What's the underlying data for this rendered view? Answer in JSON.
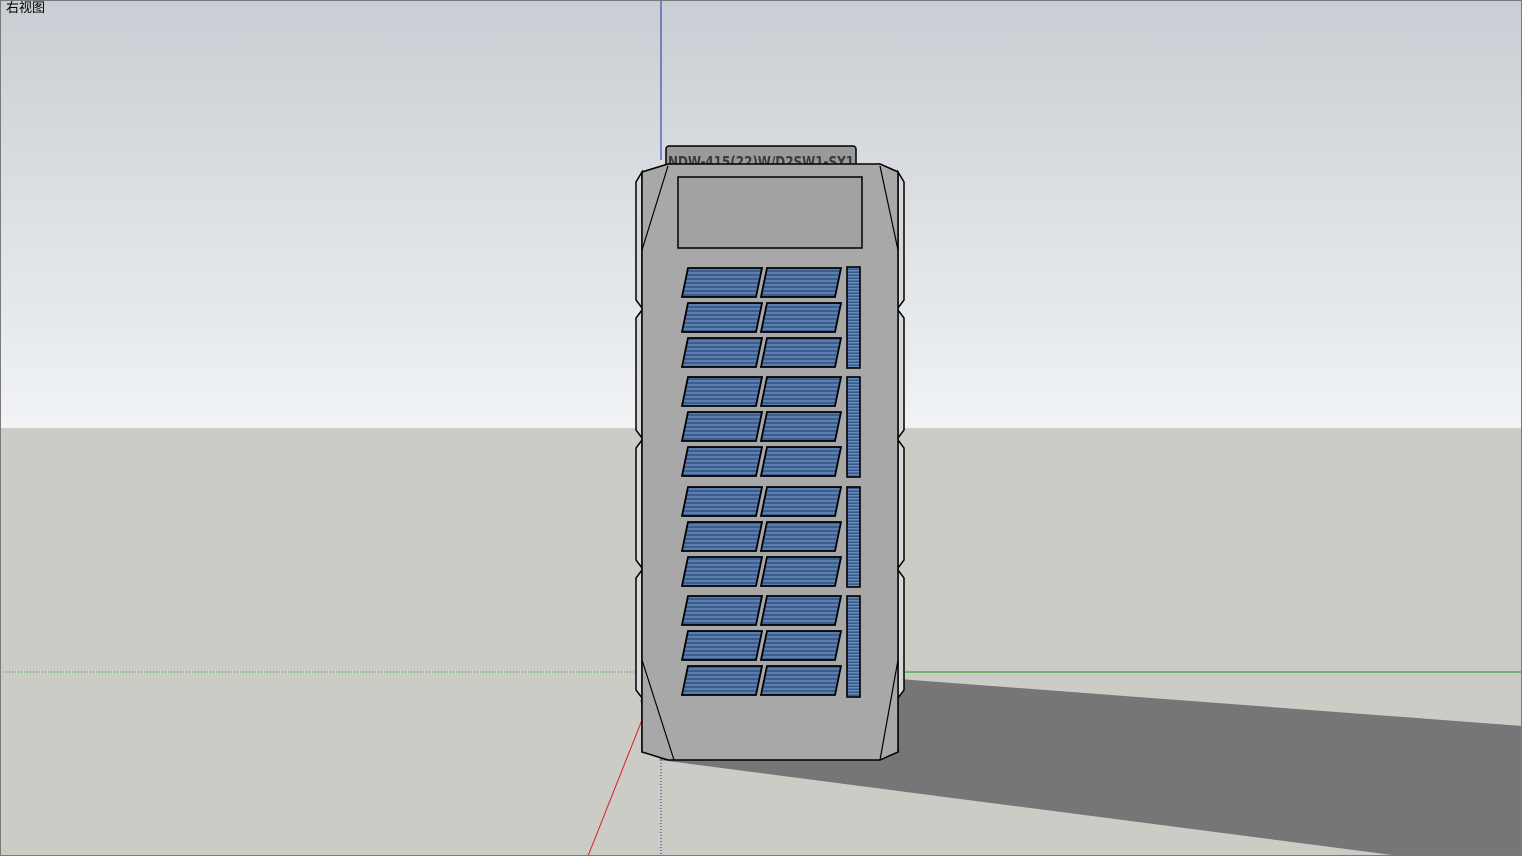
{
  "viewport": {
    "view_name": "右视图"
  },
  "model": {
    "sign_text": "NDW-415(22)W/D2SW1-SY1"
  },
  "colors": {
    "sky_top": "#c8ced3",
    "sky_bottom": "#f0f2f4",
    "ground": "#cbccc6",
    "shadow": "#757675",
    "building_face": "#a8a8a8",
    "building_side": "#e2e2e2",
    "window_glass": "#3f5f8c",
    "axis_blue": "#1e2ab4",
    "axis_red": "#d42020",
    "axis_green": "#1f9a1f"
  }
}
